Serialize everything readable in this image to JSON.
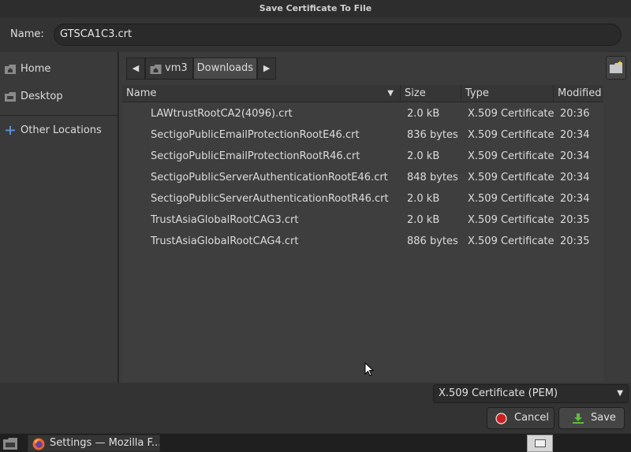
{
  "window": {
    "title": "Save Certificate To File"
  },
  "name_field": {
    "label": "Name:",
    "value": "GTSCA1C3.crt"
  },
  "sidebar": {
    "items": [
      {
        "label": "Home",
        "icon": "home-folder-icon"
      },
      {
        "label": "Desktop",
        "icon": "desktop-folder-icon"
      },
      {
        "label": "Other Locations",
        "icon": "plus-icon"
      }
    ]
  },
  "pathbar": {
    "segments": [
      "vm3",
      "Downloads"
    ],
    "icon": "home-folder-icon"
  },
  "columns": {
    "name": "Name",
    "size": "Size",
    "type": "Type",
    "modified": "Modified"
  },
  "files": [
    {
      "name": "LAWtrustRootCA2(4096).crt",
      "size": "2.0 kB",
      "type": "X.509 Certificate",
      "modified": "20:36"
    },
    {
      "name": "SectigoPublicEmailProtectionRootE46.crt",
      "size": "836 bytes",
      "type": "X.509 Certificate",
      "modified": "20:34"
    },
    {
      "name": "SectigoPublicEmailProtectionRootR46.crt",
      "size": "2.0 kB",
      "type": "X.509 Certificate",
      "modified": "20:34"
    },
    {
      "name": "SectigoPublicServerAuthenticationRootE46.crt",
      "size": "848 bytes",
      "type": "X.509 Certificate",
      "modified": "20:34"
    },
    {
      "name": "SectigoPublicServerAuthenticationRootR46.crt",
      "size": "2.0 kB",
      "type": "X.509 Certificate",
      "modified": "20:34"
    },
    {
      "name": "TrustAsiaGlobalRootCAG3.crt",
      "size": "2.0 kB",
      "type": "X.509 Certificate",
      "modified": "20:35"
    },
    {
      "name": "TrustAsiaGlobalRootCAG4.crt",
      "size": "886 bytes",
      "type": "X.509 Certificate",
      "modified": "20:35"
    }
  ],
  "filter": {
    "value": "X.509 Certificate (PEM)"
  },
  "buttons": {
    "cancel": "Cancel",
    "save": "Save"
  },
  "taskbar": {
    "task_label": "Settings — Mozilla F..."
  },
  "colors": {
    "cancel_icon": "#cc1f1f",
    "save_icon": "#5bbf3a",
    "window_bg": "#2b2b2b"
  }
}
